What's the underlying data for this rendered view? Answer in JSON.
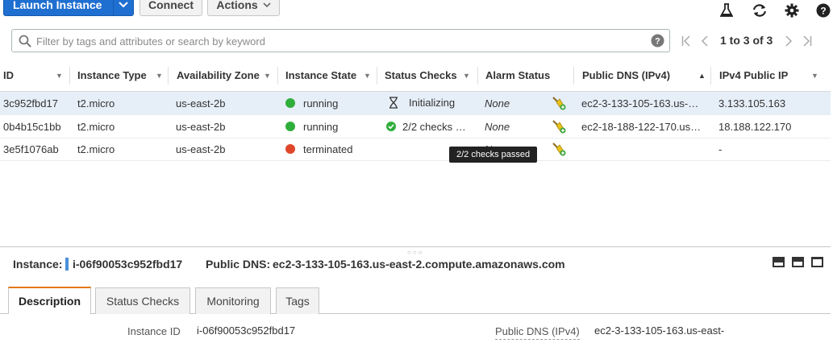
{
  "toolbar": {
    "launch_label": "Launch Instance",
    "connect_label": "Connect",
    "actions_label": "Actions",
    "icons": [
      "flask-icon",
      "refresh-icon",
      "gear-icon",
      "help-icon"
    ]
  },
  "search": {
    "placeholder": "Filter by tags and attributes or search by keyword",
    "pager": "1 to 3 of 3"
  },
  "table": {
    "columns": [
      "ID",
      "Instance Type",
      "Availability Zone",
      "Instance State",
      "Status Checks",
      "Alarm Status",
      "Public DNS (IPv4)",
      "IPv4 Public IP"
    ],
    "rows": [
      {
        "id": "3c952fbd17",
        "type": "t2.micro",
        "az": "us-east-2b",
        "state": "running",
        "state_color": "#2fae3b",
        "checks": "Initializing",
        "alarm": "None",
        "dns": "ec2-3-133-105-163.us-…",
        "ip": "3.133.105.163",
        "selected": true
      },
      {
        "id": "0b4b15c1bb",
        "type": "t2.micro",
        "az": "us-east-2b",
        "state": "running",
        "state_color": "#2fae3b",
        "checks": "2/2 checks …",
        "alarm": "None",
        "dns": "ec2-18-188-122-170.us…",
        "ip": "18.188.122.170",
        "selected": false
      },
      {
        "id": "3e5f1076ab",
        "type": "t2.micro",
        "az": "us-east-2b",
        "state": "terminated",
        "state_color": "#e0462a",
        "checks": "",
        "alarm": "N",
        "dns": "",
        "ip": "-",
        "selected": false
      }
    ],
    "tooltip": "2/2 checks passed"
  },
  "details": {
    "instance_label": "Instance:",
    "instance_id": "i-06f90053c952fbd17",
    "dns_label": "Public DNS:",
    "dns_value": "ec2-3-133-105-163.us-east-2.compute.amazonaws.com",
    "tabs": [
      "Description",
      "Status Checks",
      "Monitoring",
      "Tags"
    ],
    "fields": {
      "instance_id_label": "Instance ID",
      "instance_id_value": "i-06f90053c952fbd17",
      "public_dns_label": "Public DNS (IPv4)",
      "public_dns_value": "ec2-3-133-105-163.us-east-"
    }
  }
}
